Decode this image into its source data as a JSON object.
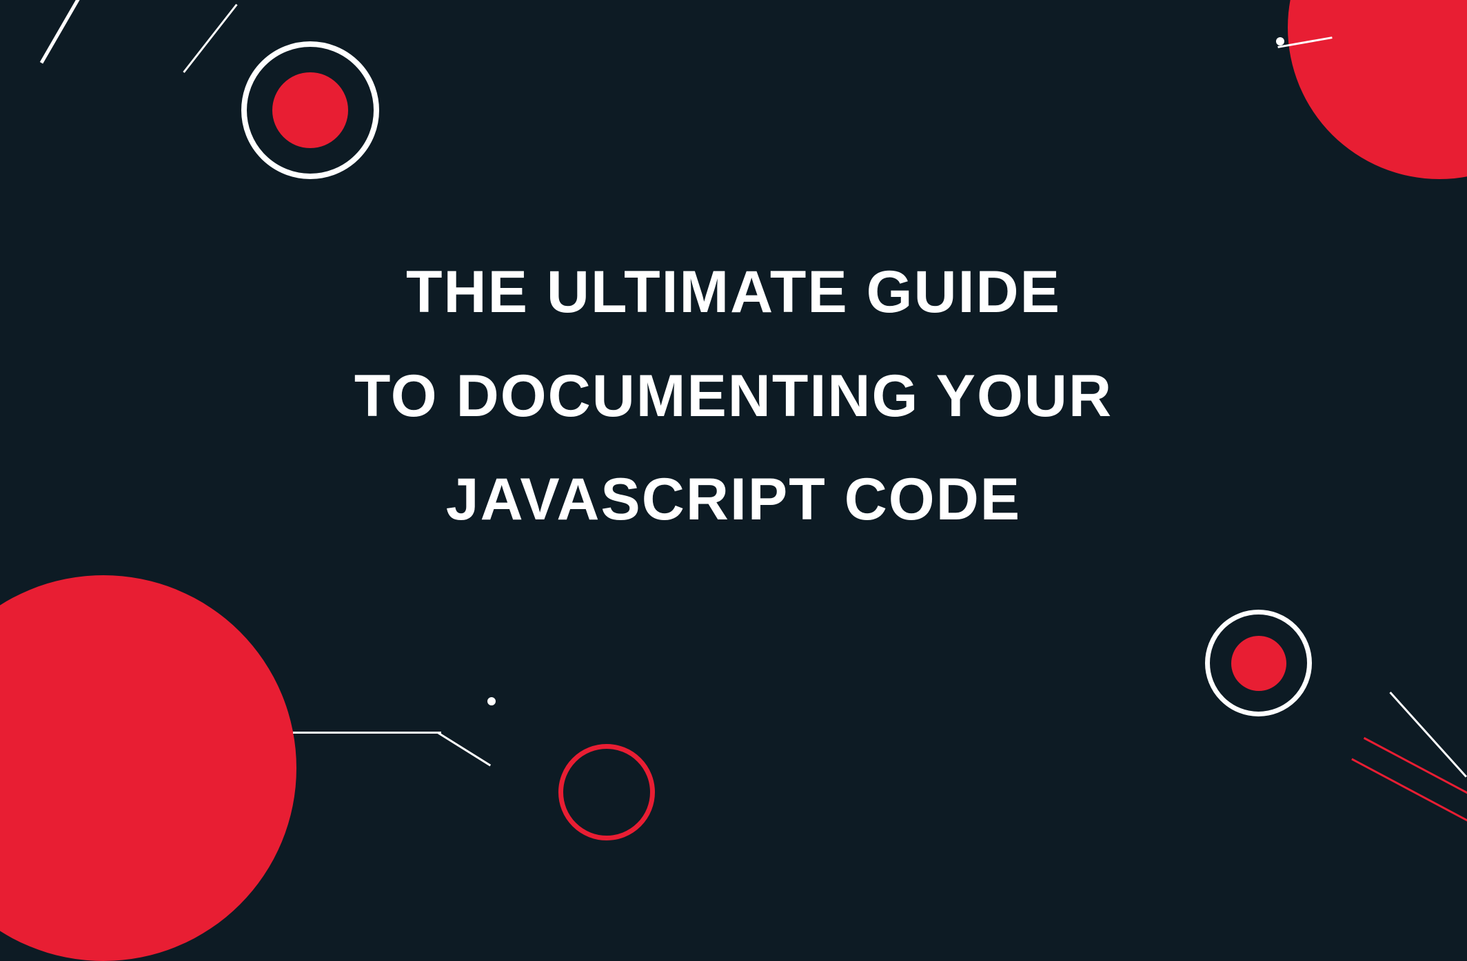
{
  "title": {
    "line1": "THE ULTIMATE GUIDE",
    "line2": "TO DOCUMENTING YOUR",
    "line3": "JAVASCRIPT CODE"
  },
  "colors": {
    "background": "#0d1b24",
    "accent": "#e81e33",
    "text": "#ffffff"
  }
}
